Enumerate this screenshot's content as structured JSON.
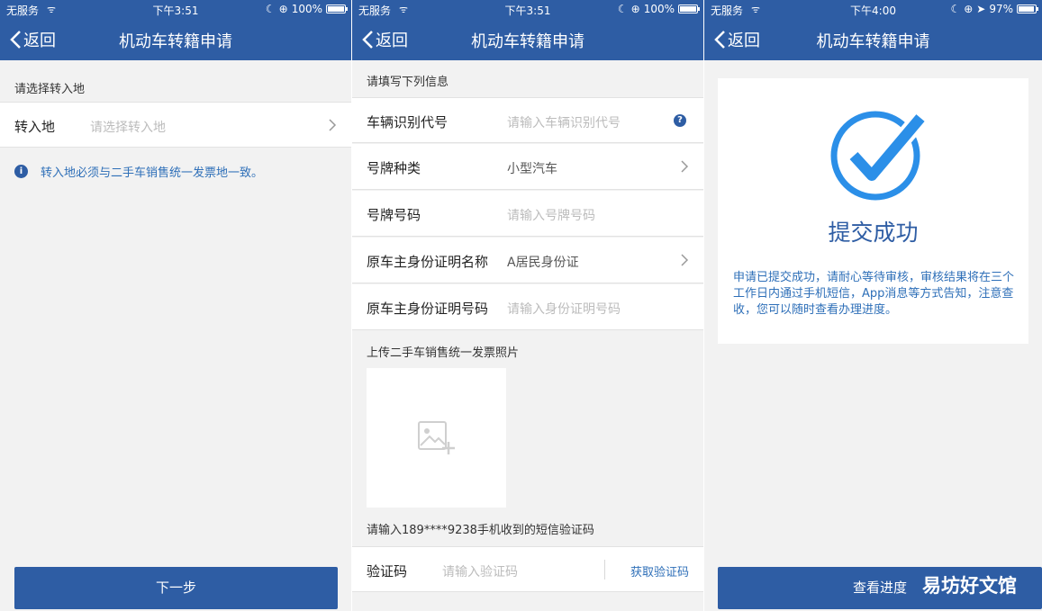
{
  "status1": {
    "carrier": "无服务",
    "time": "下午3:51",
    "battery": "100%"
  },
  "status2": {
    "carrier": "无服务",
    "time": "下午3:51",
    "battery": "100%"
  },
  "status3": {
    "carrier": "无服务",
    "time": "下午4:00",
    "battery": "97%"
  },
  "battery_levels": [
    1.0,
    1.0,
    0.97
  ],
  "nav": {
    "back": "返回",
    "title": "机动车转籍申请"
  },
  "screen1": {
    "section": "请选择转入地",
    "row_label": "转入地",
    "row_placeholder": "请选择转入地",
    "notice": "转入地必须与二手车销售统一发票地一致。",
    "next_button": "下一步"
  },
  "screen2": {
    "section": "请填写下列信息",
    "rows": [
      {
        "label": "车辆识别代号",
        "value": "请输入车辆识别代号"
      },
      {
        "label": "号牌种类",
        "value": "小型汽车"
      },
      {
        "label": "号牌号码",
        "value": "请输入号牌号码"
      },
      {
        "label": "原车主身份证明名称",
        "value": "A居民身份证"
      },
      {
        "label": "原车主身份证明号码",
        "value": "请输入身份证明号码"
      }
    ],
    "upload_label": "上传二手车销售统一发票照片",
    "sms_label": "请输入189****9238手机收到的短信验证码",
    "code_label": "验证码",
    "code_placeholder": "请输入验证码",
    "get_code": "获取验证码",
    "help_icon_text": "?"
  },
  "screen3": {
    "title": "提交成功",
    "message": "申请已提交成功，请耐心等待审核，审核结果将在三个工作日内通过手机短信，App消息等方式告知，注意查收，您可以随时查看办理进度。",
    "button": "查看进度",
    "watermark": "易坊好文馆"
  },
  "colors": {
    "brand": "#2e5da4",
    "link": "#2e6fb8",
    "success": "#2b8fe8"
  }
}
